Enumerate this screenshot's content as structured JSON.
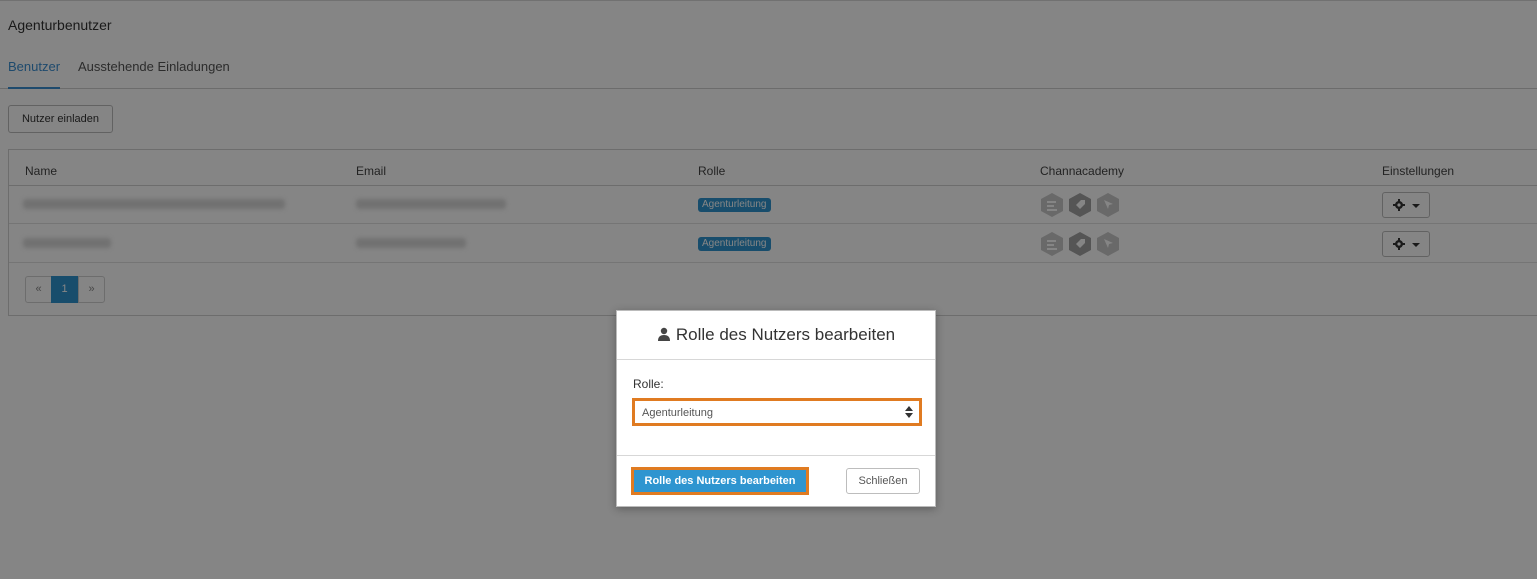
{
  "page": {
    "title": "Agenturbenutzer"
  },
  "tabs": [
    {
      "label": "Benutzer",
      "active": true
    },
    {
      "label": "Ausstehende Einladungen",
      "active": false
    }
  ],
  "toolbar": {
    "invite_label": "Nutzer einladen"
  },
  "table": {
    "columns": [
      "Name",
      "Email",
      "Rolle",
      "Channacademy",
      "Einstellungen"
    ],
    "rows": [
      {
        "role": "Agenturleitung",
        "academy_icons": [
          "course-icon",
          "tag-icon",
          "cursor-icon"
        ]
      },
      {
        "role": "Agenturleitung",
        "academy_icons": [
          "course-icon",
          "tag-icon",
          "cursor-icon"
        ]
      }
    ]
  },
  "pagination": {
    "prev": "«",
    "current": "1",
    "next": "»"
  },
  "modal": {
    "title": "Rolle des Nutzers bearbeiten",
    "role_label": "Rolle:",
    "role_value": "Agenturleitung",
    "submit_label": "Rolle des Nutzers bearbeiten",
    "close_label": "Schließen",
    "highlight_color": "#e07b21"
  },
  "colors": {
    "accent": "#2e95d0",
    "highlight": "#e07b21"
  }
}
